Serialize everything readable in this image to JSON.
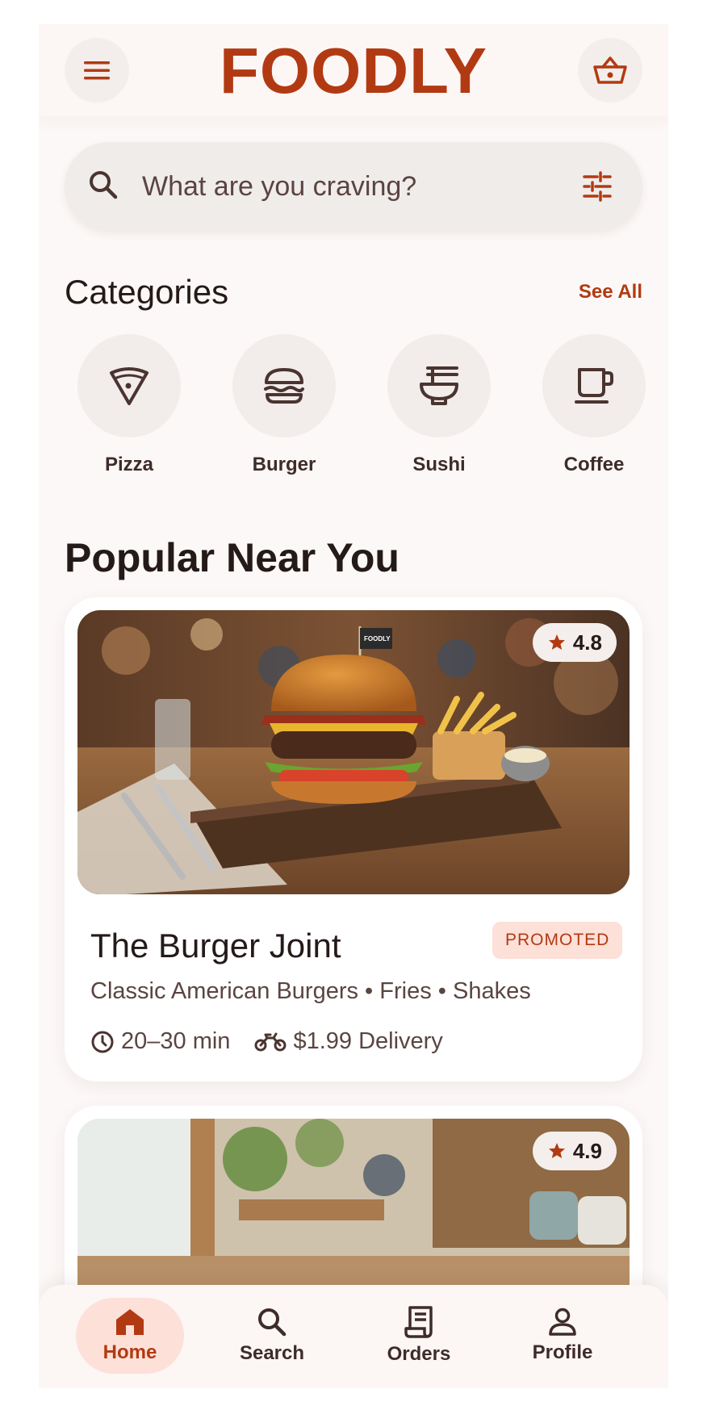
{
  "app": {
    "logo": "FOODLY"
  },
  "header": {
    "menu_icon": "hamburger-menu-icon",
    "cart_icon": "basket-icon"
  },
  "search": {
    "placeholder": "What are you craving?",
    "value": "",
    "icon": "search-icon",
    "filter_icon": "filter-sliders-icon"
  },
  "categories": {
    "title": "Categories",
    "see_all": "See All",
    "items": [
      {
        "label": "Pizza",
        "icon": "pizza-icon"
      },
      {
        "label": "Burger",
        "icon": "burger-icon"
      },
      {
        "label": "Sushi",
        "icon": "ramen-bowl-icon"
      },
      {
        "label": "Coffee",
        "icon": "coffee-cup-icon"
      }
    ]
  },
  "popular": {
    "title": "Popular Near You",
    "restaurants": [
      {
        "rating": "4.8",
        "name": "The Burger Joint",
        "badge": "PROMOTED",
        "cuisine": "Classic American Burgers • Fries • Shakes",
        "time": "20–30 min",
        "delivery": "$1.99 Delivery",
        "flag_text": "FOODLY"
      },
      {
        "rating": "4.9"
      }
    ]
  },
  "nav": {
    "items": [
      {
        "label": "Home",
        "icon": "home-icon",
        "active": true
      },
      {
        "label": "Search",
        "icon": "search-icon",
        "active": false
      },
      {
        "label": "Orders",
        "icon": "receipt-icon",
        "active": false
      },
      {
        "label": "Profile",
        "icon": "person-icon",
        "active": false
      }
    ]
  },
  "colors": {
    "accent": "#b23a12",
    "accent_soft": "#fde0d8",
    "text": "#241a18",
    "surface": "#fcf8f7"
  }
}
